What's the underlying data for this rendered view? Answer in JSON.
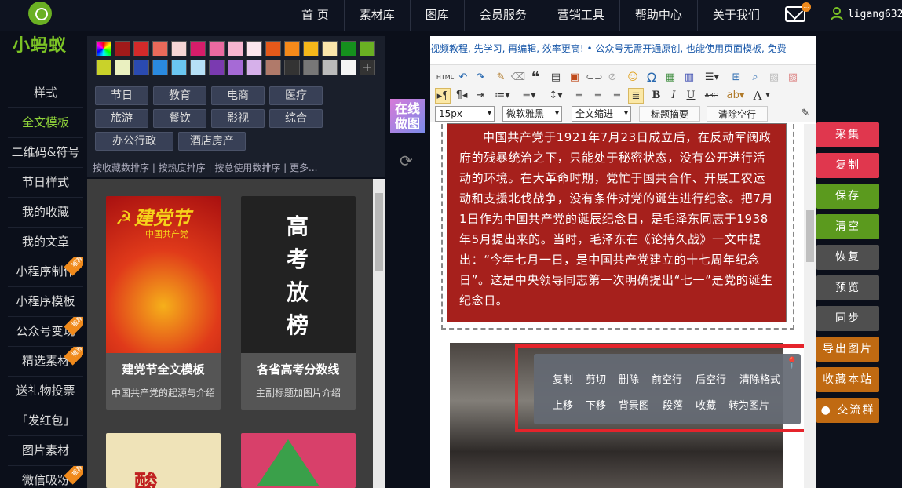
{
  "brand": {
    "name": "小蚂蚁"
  },
  "nav": {
    "items": [
      "首 页",
      "素材库",
      "图库",
      "会员服务",
      "营销工具",
      "帮助中心",
      "关于我们"
    ]
  },
  "user": {
    "name": "ligang632",
    "notify": "..."
  },
  "sidebar": {
    "items": [
      {
        "label": "样式",
        "badge": ""
      },
      {
        "label": "全文模板",
        "badge": ""
      },
      {
        "label": "二维码&符号",
        "badge": ""
      },
      {
        "label": "节日样式",
        "badge": ""
      },
      {
        "label": "我的收藏",
        "badge": ""
      },
      {
        "label": "我的文章",
        "badge": ""
      },
      {
        "label": "小程序制作",
        "badge": "推荐"
      },
      {
        "label": "小程序模板",
        "badge": ""
      },
      {
        "label": "公众号变现",
        "badge": "推荐"
      },
      {
        "label": "精选素材",
        "badge": "推荐"
      },
      {
        "label": "送礼物投票",
        "badge": ""
      },
      {
        "label": "「发红包」",
        "badge": ""
      },
      {
        "label": "图片素材",
        "badge": ""
      },
      {
        "label": "微信吸粉",
        "badge": "推荐"
      }
    ],
    "active_label": "全文模板"
  },
  "palette": {
    "row1": [
      "#a01a1a",
      "#d32a2a",
      "#ea6a5a",
      "#f6d6d6",
      "#d61d6a",
      "#ea6aa0",
      "#f6b6d0",
      "#fbe6ee",
      "#e5591a",
      "#f68a1a",
      "#f6b81a",
      "#fbe6aa",
      "#15901d",
      "#6ab023"
    ],
    "row2": [
      "#c9d22a",
      "#eaf0c0",
      "#2a4ab0",
      "#2a8ae0",
      "#6ac6f0",
      "#b6e0f6",
      "#7a3ab0",
      "#a66ad6",
      "#d6b0ea",
      "#b07a6a",
      "#333333",
      "#777777",
      "#bbbbbb",
      "#f4f4f4"
    ]
  },
  "categories": [
    "节日",
    "教育",
    "电商",
    "医疗",
    "旅游",
    "餐饮",
    "影视",
    "综合",
    "办公行政",
    "酒店房产"
  ],
  "sort": {
    "text": "按收藏数排序 | 按热度排序 | 按总使用数排序 | 更多..."
  },
  "templates": [
    {
      "image_text": "建党节",
      "image_subtext": "中国共产党",
      "title": "建党节全文模板",
      "subtitle": "中国共产党的起源与介绍"
    },
    {
      "image_text": "高考放榜",
      "title": "各省高考分数线",
      "subtitle": "主副标题加图片介绍"
    },
    {
      "image_text": "酸"
    }
  ],
  "online_button": {
    "line1": "在线",
    "line2": "做图"
  },
  "editor": {
    "ticker": "视频教程, 先学习, 再编辑, 效率更高!   •  公众号无需开通原创, 也能使用页面模板, 免费",
    "font_size": "15px",
    "font_family": "微软雅黑",
    "indent": "全文缩进",
    "summary_button": "标题摘要",
    "clear_blank_button": "清除空行",
    "body_text": "中国共产党于1921年7月23日成立后，在反动军阀政府的残暴统治之下，只能处于秘密状态，没有公开进行活动的环境。在大革命时期，党忙于国共合作、开展工农运动和支援北伐战争，没有条件对党的诞生进行纪念。把7月1日作为中国共产党的诞辰纪念日，是毛泽东同志于1938年5月提出来的。当时，毛泽东在《论持久战》一文中提出：“今年七月一日，是中国共产党建立的十七周年纪念日”。这是中央领导同志第一次明确提出“七一”是党的诞生纪念日。",
    "toolbar_labels": {
      "html": "HTML",
      "omega": "Ω",
      "bold": "B",
      "italic": "I",
      "underline": "U",
      "strike": "ABC",
      "font_color": "A"
    }
  },
  "popup": {
    "row1": [
      "复制",
      "剪切",
      "删除",
      "前空行",
      "后空行",
      "清除格式"
    ],
    "row2": [
      "上移",
      "下移",
      "背景图",
      "段落",
      "收藏",
      "转为图片"
    ]
  },
  "right_buttons": [
    {
      "label": "采集",
      "color": "#e0374e"
    },
    {
      "label": "复制",
      "color": "#e0374e"
    },
    {
      "label": "保存",
      "color": "#5b9a1e"
    },
    {
      "label": "清空",
      "color": "#5b9a1e"
    },
    {
      "label": "恢复",
      "color": "#4f4f4f"
    },
    {
      "label": "预览",
      "color": "#4f4f4f"
    },
    {
      "label": "同步",
      "color": "#4f4f4f"
    },
    {
      "label": "导出图片",
      "color": "#c06a12"
    },
    {
      "label": "收藏本站",
      "color": "#c06a12"
    },
    {
      "label": "交流群",
      "color": "#c06a12"
    }
  ]
}
